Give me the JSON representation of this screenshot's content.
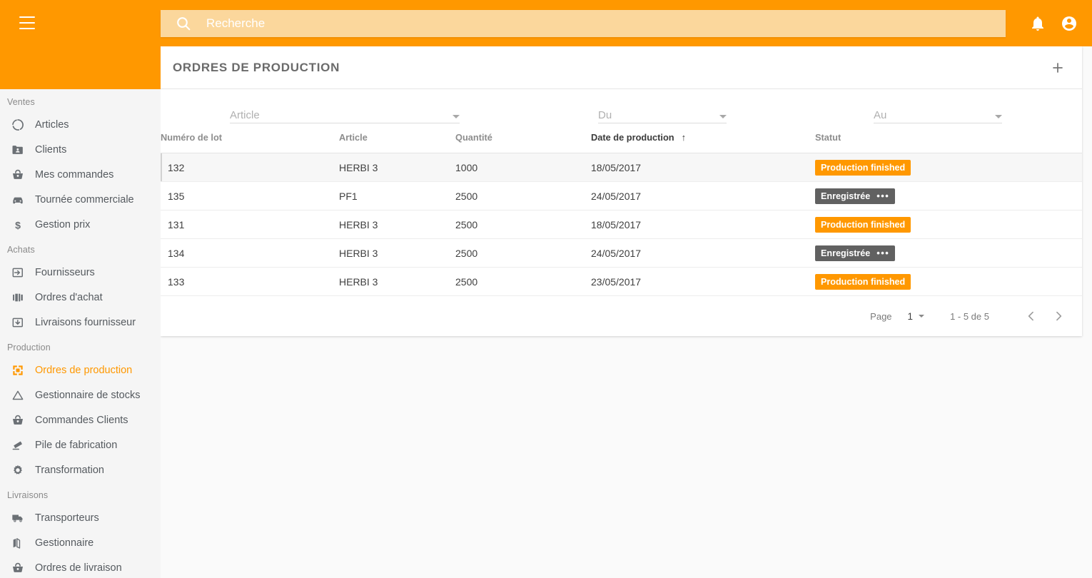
{
  "header": {
    "menu_icon": "hamburger-menu-icon",
    "search": {
      "icon": "search-icon",
      "placeholder": "Recherche",
      "value": ""
    },
    "notifications_icon": "bell-icon",
    "account_icon": "account-circle-icon"
  },
  "sidebar": {
    "groups": [
      {
        "label": "Ventes",
        "items": [
          {
            "label": "Articles",
            "icon": "broken-circle-icon",
            "active": false
          },
          {
            "label": "Clients",
            "icon": "contact-folder-icon",
            "active": false
          },
          {
            "label": "Mes commandes",
            "icon": "basket-icon",
            "active": false
          },
          {
            "label": "Tournée commerciale",
            "icon": "car-icon",
            "active": false
          },
          {
            "label": "Gestion prix",
            "icon": "dollar-icon",
            "active": false
          }
        ]
      },
      {
        "label": "Achats",
        "items": [
          {
            "label": "Fournisseurs",
            "icon": "login-arrow-box-icon",
            "active": false
          },
          {
            "label": "Ordres d'achat",
            "icon": "bar-blocks-icon",
            "active": false
          },
          {
            "label": "Livraisons fournisseur",
            "icon": "download-box-icon",
            "active": false
          }
        ]
      },
      {
        "label": "Production",
        "items": [
          {
            "label": "Ordres de production",
            "icon": "four-squares-icon",
            "active": true
          },
          {
            "label": "Gestionnaire de stocks",
            "icon": "triangle-icon",
            "active": false
          },
          {
            "label": "Commandes Clients",
            "icon": "basket-icon",
            "active": false
          },
          {
            "label": "Pile de fabrication",
            "icon": "stack-lines-icon",
            "active": false
          },
          {
            "label": "Transformation",
            "icon": "gear-icon",
            "active": false
          }
        ]
      },
      {
        "label": "Livraisons",
        "items": [
          {
            "label": "Transporteurs",
            "icon": "truck-icon",
            "active": false
          },
          {
            "label": "Gestionnaire",
            "icon": "map-icon",
            "active": false
          },
          {
            "label": "Ordres de livraison",
            "icon": "basket-icon",
            "active": false
          }
        ]
      }
    ]
  },
  "main": {
    "title": "ORDRES DE PRODUCTION",
    "add_icon": "plus-icon",
    "filters": [
      {
        "id": "article",
        "label": "Article",
        "value": ""
      },
      {
        "id": "du",
        "label": "Du",
        "value": ""
      },
      {
        "id": "au",
        "label": "Au",
        "value": ""
      }
    ],
    "table": {
      "columns": [
        {
          "key": "lot",
          "label": "Numéro de lot",
          "sorted": false
        },
        {
          "key": "article",
          "label": "Article",
          "sorted": false
        },
        {
          "key": "quantite",
          "label": "Quantité",
          "sorted": false
        },
        {
          "key": "date",
          "label": "Date de production",
          "sorted": true,
          "sort_dir": "↑"
        },
        {
          "key": "statut",
          "label": "Statut",
          "sorted": false
        }
      ],
      "rows": [
        {
          "lot": "132",
          "article": "HERBI 3",
          "quantite": "1000",
          "date": "18/05/2017",
          "statut": "Production finished",
          "statut_style": "orange",
          "has_menu": false,
          "hovered": true
        },
        {
          "lot": "135",
          "article": "PF1",
          "quantite": "2500",
          "date": "24/05/2017",
          "statut": "Enregistrée",
          "statut_style": "grey",
          "has_menu": true,
          "hovered": false
        },
        {
          "lot": "131",
          "article": "HERBI 3",
          "quantite": "2500",
          "date": "18/05/2017",
          "statut": "Production finished",
          "statut_style": "orange",
          "has_menu": false,
          "hovered": false
        },
        {
          "lot": "134",
          "article": "HERBI 3",
          "quantite": "2500",
          "date": "24/05/2017",
          "statut": "Enregistrée",
          "statut_style": "grey",
          "has_menu": true,
          "hovered": false
        },
        {
          "lot": "133",
          "article": "HERBI 3",
          "quantite": "2500",
          "date": "23/05/2017",
          "statut": "Production finished",
          "statut_style": "orange",
          "has_menu": false,
          "hovered": false
        }
      ]
    },
    "paginator": {
      "page_label": "Page",
      "page_value": "1",
      "range_label": "1 - 5 de 5",
      "prev_icon": "chevron-left-icon",
      "next_icon": "chevron-right-icon"
    }
  },
  "colors": {
    "brand_orange": "#FF9800",
    "search_bg": "#FBD79C",
    "status_grey": "#616161"
  }
}
